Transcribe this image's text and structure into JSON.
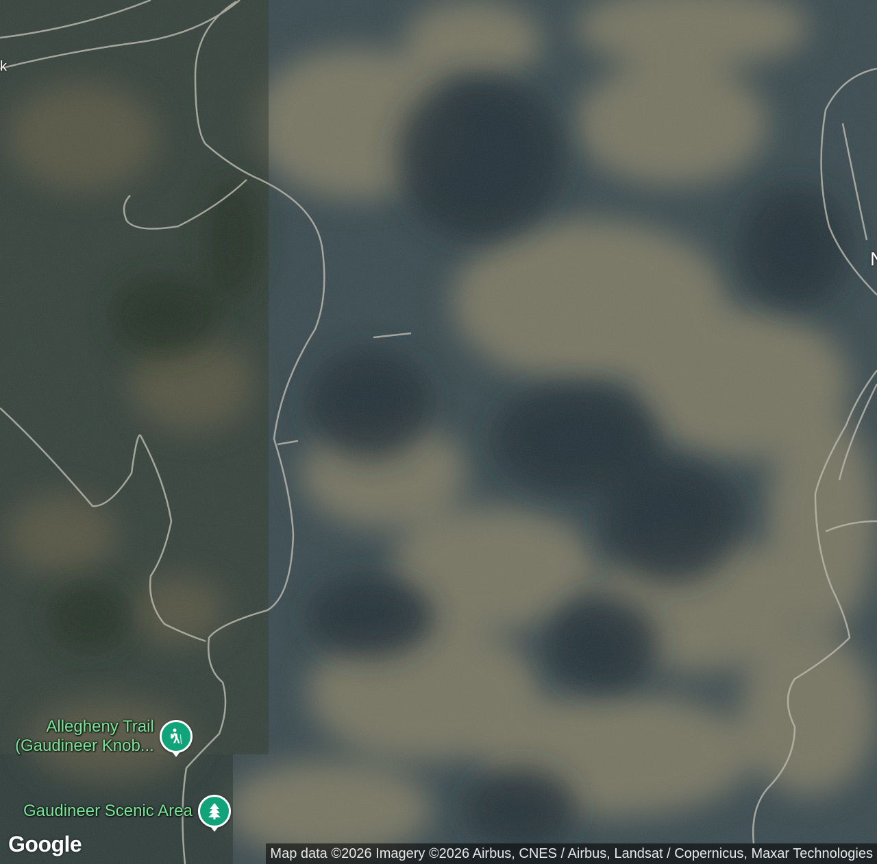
{
  "map": {
    "type": "satellite",
    "attribution": "Map data ©2026 Imagery ©2026 Airbus, CNES / Airbus, Landsat / Copernicus, Maxar Technologies",
    "logo": "Google",
    "road_label_fragments": [
      "k",
      "N"
    ]
  },
  "pois": [
    {
      "name_line1": "Allegheny Trail",
      "name_line2": "(Gaudineer Knob...",
      "icon": "hiker-icon",
      "color": "#11a37a"
    },
    {
      "name_line1": "Gaudineer Scenic Area",
      "icon": "tree-icon",
      "color": "#11a37a"
    }
  ],
  "colors": {
    "poi_label": "#7ee29a",
    "forest_dark": "#1f2f35",
    "forest_light": "#8a8265"
  }
}
